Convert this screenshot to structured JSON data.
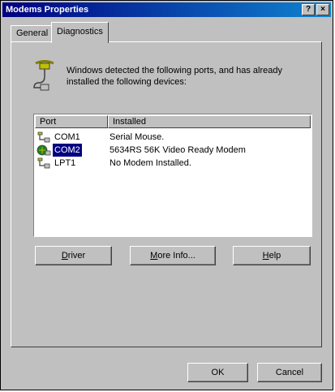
{
  "window": {
    "title": "Modems Properties"
  },
  "titlebar_buttons": {
    "help": "?",
    "close": "×"
  },
  "tabs": [
    {
      "label": "General"
    },
    {
      "label": "Diagnostics"
    }
  ],
  "info": {
    "text": "Windows detected the following ports, and has already installed the following devices:"
  },
  "list": {
    "columns": [
      "Port",
      "Installed"
    ],
    "rows": [
      {
        "port": "COM1",
        "installed": "Serial Mouse.",
        "icon": "port-icon"
      },
      {
        "port": "COM2",
        "installed": "5634RS 56K Video Ready Modem",
        "icon": "modem-icon",
        "selected": true
      },
      {
        "port": "LPT1",
        "installed": "No Modem Installed.",
        "icon": "port-icon"
      }
    ]
  },
  "buttons": {
    "driver": {
      "mnemonic": "D",
      "rest": "river"
    },
    "more_info": {
      "mnemonic": "M",
      "rest": "ore Info..."
    },
    "help": {
      "mnemonic": "H",
      "rest": "elp"
    },
    "ok": "OK",
    "cancel": "Cancel"
  }
}
